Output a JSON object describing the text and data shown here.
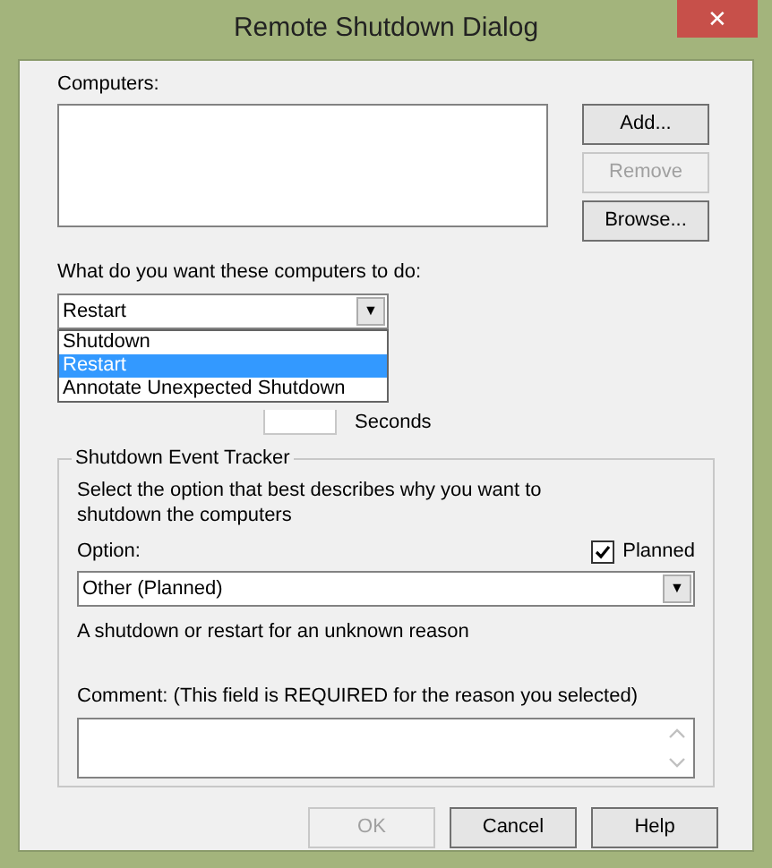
{
  "window": {
    "title": "Remote Shutdown Dialog",
    "close": "✕"
  },
  "computers": {
    "label": "Computers:"
  },
  "side_buttons": [
    {
      "label": "Add...",
      "disabled": false
    },
    {
      "label": "Remove",
      "disabled": true
    },
    {
      "label": "Browse...",
      "disabled": false
    }
  ],
  "action": {
    "label": "What do you want these computers to do:",
    "value": "Restart",
    "arrow": "▼",
    "options": [
      {
        "label": "Shutdown",
        "selected": false
      },
      {
        "label": "Restart",
        "selected": true
      },
      {
        "label": "Annotate Unexpected Shutdown",
        "selected": false
      }
    ]
  },
  "warning": {
    "unit": "Seconds"
  },
  "tracker": {
    "title": "Shutdown Event Tracker",
    "description": "Select the option that best describes why you want to shutdown the computers",
    "option_label": "Option:",
    "planned": {
      "label": "Planned",
      "checked": true
    },
    "option_value": "Other (Planned)",
    "arrow": "▼",
    "reason": "A shutdown or restart for an unknown reason",
    "comment_label": "Comment: (This field is REQUIRED for the reason you selected)"
  },
  "buttons": [
    {
      "label": "OK",
      "disabled": true
    },
    {
      "label": "Cancel",
      "disabled": false
    },
    {
      "label": "Help",
      "disabled": false
    }
  ]
}
